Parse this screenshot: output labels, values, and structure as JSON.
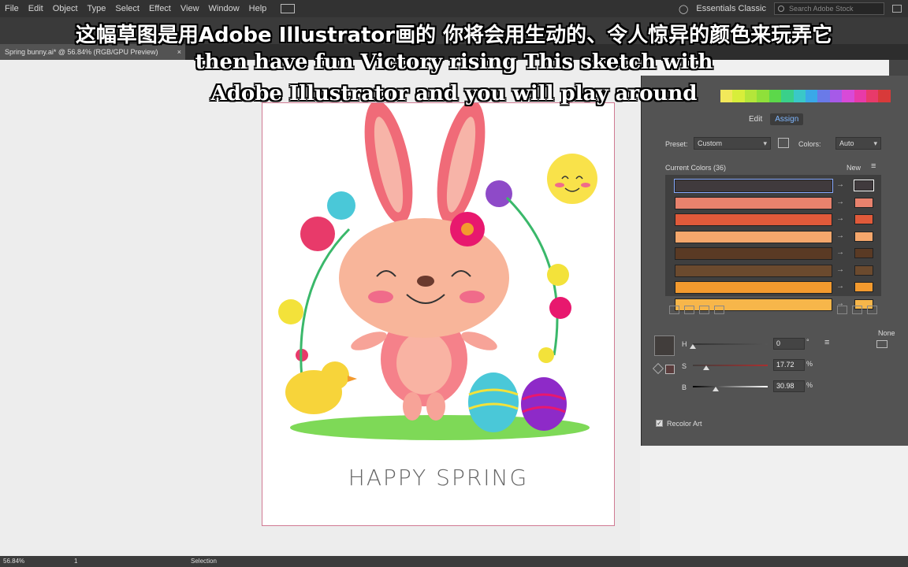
{
  "menu": {
    "items": [
      "File",
      "Edit",
      "Object",
      "Type",
      "Select",
      "Effect",
      "View",
      "Window",
      "Help"
    ],
    "workspace": "Essentials Classic",
    "search_placeholder": "Search Adobe Stock"
  },
  "document": {
    "tab_title": "Spring bunny.ai* @ 56.84% (RGB/GPU Preview)",
    "close": "×"
  },
  "subtitles": {
    "line1": "这幅草图是用Adobe Illustrator画的 你将会用生动的、令人惊异的颜色来玩弄它",
    "line2": "then have fun Victory rising This sketch with",
    "line3": "Adobe Illustrator and you will play around"
  },
  "artwork": {
    "caption": "HAPPY SPRING"
  },
  "recolor": {
    "tabs": [
      "Edit",
      "Assign"
    ],
    "active_tab": "Assign",
    "preset_label": "Preset:",
    "preset_value": "Custom",
    "colors_label": "Colors:",
    "colors_value": "Auto",
    "current_colors": "Current Colors (36)",
    "new_label": "New",
    "rows": [
      {
        "current": "#403a3d",
        "new": "#403a3d"
      },
      {
        "current": "#e8826d",
        "new": "#e8826d"
      },
      {
        "current": "#e05a3a",
        "new": "#e05a3a"
      },
      {
        "current": "#f5a76c",
        "new": "#f5a76c"
      },
      {
        "current": "#5a3a24",
        "new": "#5a3a24"
      },
      {
        "current": "#6b4a2e",
        "new": "#6b4a2e"
      },
      {
        "current": "#f39a2e",
        "new": "#f39a2e"
      },
      {
        "current": "#f7b64a",
        "new": "#f7b64a"
      }
    ],
    "harmony_colors": [
      "#f2e85a",
      "#d8ee3a",
      "#b4e63a",
      "#8fe03a",
      "#5cd84a",
      "#3ad08a",
      "#3ac8c8",
      "#3aa8e8",
      "#6a7ae8",
      "#a65ae8",
      "#d84ad8",
      "#e83aa8",
      "#e83a6a",
      "#d83a3a"
    ],
    "none_label": "None",
    "h_label": "H",
    "h_value": "0",
    "h_unit": "°",
    "s_label": "S",
    "s_value": "17.72",
    "s_unit": "%",
    "b_label": "B",
    "b_value": "30.98",
    "b_unit": "%",
    "h_level": 0.0,
    "s_level": 0.1772,
    "b_level": 0.3098,
    "recolor_art_label": "Recolor Art",
    "recolor_art_checked": true
  },
  "status": {
    "zoom": "56.84%",
    "artboard": "1",
    "tool": "Selection"
  }
}
